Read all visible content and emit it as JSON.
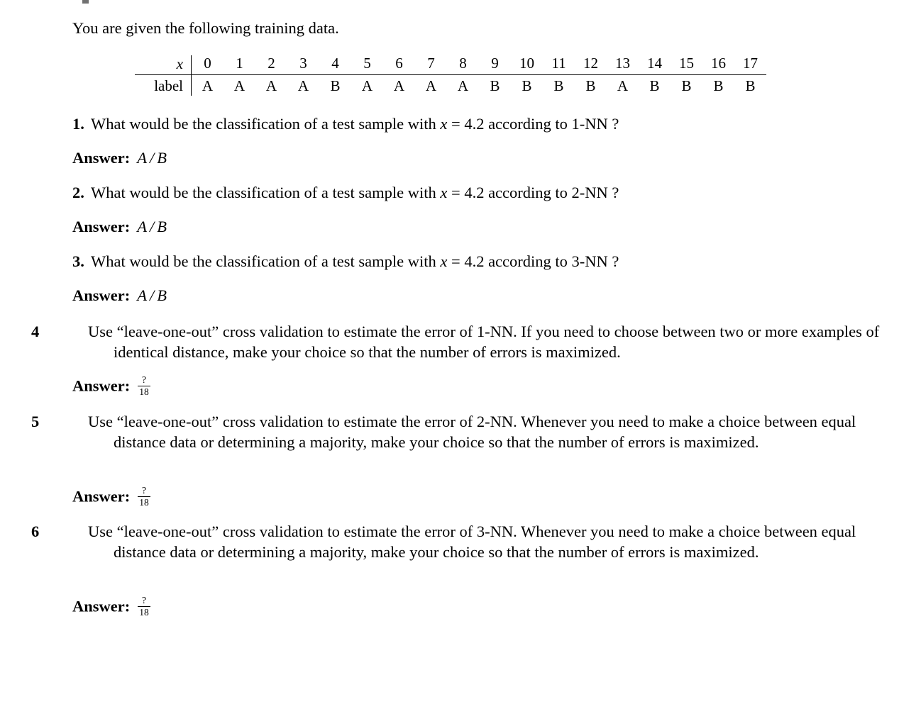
{
  "document": {
    "intro": "You are given the following training data."
  },
  "table": {
    "row_headers": [
      "x",
      "label"
    ],
    "x_values": [
      "0",
      "1",
      "2",
      "3",
      "4",
      "5",
      "6",
      "7",
      "8",
      "9",
      "10",
      "11",
      "12",
      "13",
      "14",
      "15",
      "16",
      "17"
    ],
    "labels": [
      "A",
      "A",
      "A",
      "A",
      "B",
      "A",
      "A",
      "A",
      "A",
      "B",
      "B",
      "B",
      "B",
      "A",
      "B",
      "B",
      "B",
      "B"
    ]
  },
  "questions": [
    {
      "number": "1.",
      "lines": [
        "What would be the classification of a test sample with x = 4.2 according to 1-NN ?"
      ],
      "answer": {
        "label": "Answer:",
        "type": "choice",
        "options": [
          "A",
          "B"
        ],
        "separator": "/"
      }
    },
    {
      "number": "2.",
      "lines": [
        "What would be the classification of a test sample with x = 4.2 according to 2-NN ?"
      ],
      "answer": {
        "label": "Answer:",
        "type": "choice",
        "options": [
          "A",
          "B"
        ],
        "separator": "/"
      }
    },
    {
      "number": "3.",
      "lines": [
        "What would be the classification of a test sample with x = 4.2 according to 3-NN ?"
      ],
      "answer": {
        "label": "Answer:",
        "type": "choice",
        "options": [
          "A",
          "B"
        ],
        "separator": "/"
      }
    },
    {
      "number": "4",
      "lines": [
        "Use “leave-one-out” cross validation to estimate the error of 1-NN. If you need to choose between two or",
        "more examples of identical distance, make your choice so that the number of errors is maximized."
      ],
      "answer": {
        "label": "Answer:",
        "type": "fraction",
        "numerator": "?",
        "denominator": "18"
      }
    },
    {
      "number": "5",
      "lines": [
        "Use “leave-one-out” cross validation to estimate the error of 2-NN. Whenever you need to make a choice",
        "between equal distance data or determining a majority, make your choice so that the number of errors",
        "is maximized."
      ],
      "answer": {
        "label": "Answer:",
        "type": "fraction",
        "numerator": "?",
        "denominator": "18"
      }
    },
    {
      "number": "6",
      "lines": [
        "Use “leave-one-out” cross validation to estimate the error of 3-NN. Whenever you need to make a choice",
        "between equal distance data or determining a majority, make your choice so that the number of errors",
        "is maximized."
      ],
      "answer": {
        "label": "Answer:",
        "type": "fraction",
        "numerator": "?",
        "denominator": "18"
      }
    }
  ]
}
